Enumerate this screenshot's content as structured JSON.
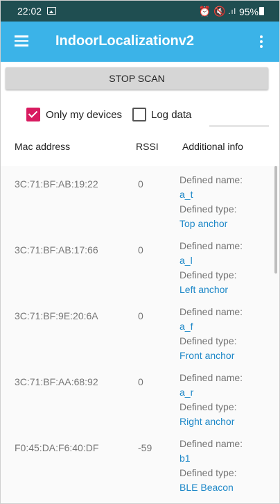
{
  "status_bar": {
    "time": "22:02",
    "battery_percent": "95%",
    "signal_text": ".ıl"
  },
  "app_bar": {
    "title": "IndoorLocalizationv2",
    "color": "#3bb3e8"
  },
  "scan_button": {
    "label": "STOP SCAN"
  },
  "options": {
    "only_my_devices": {
      "label": "Only my devices",
      "checked": true
    },
    "log_data": {
      "label": "Log data",
      "checked": false
    }
  },
  "table": {
    "headers": [
      "Mac address",
      "RSSI",
      "Additional info"
    ],
    "name_label": "Defined name:",
    "type_label": "Defined type:",
    "rows": [
      {
        "mac": "3C:71:BF:AB:19:22",
        "rssi": "0",
        "name": "a_t",
        "type": "Top anchor"
      },
      {
        "mac": "3C:71:BF:AB:17:66",
        "rssi": "0",
        "name": "a_l",
        "type": "Left anchor"
      },
      {
        "mac": "3C:71:BF:9E:20:6A",
        "rssi": "0",
        "name": "a_f",
        "type": "Front anchor"
      },
      {
        "mac": "3C:71:BF:AA:68:92",
        "rssi": "0",
        "name": "a_r",
        "type": "Right anchor"
      },
      {
        "mac": "F0:45:DA:F6:40:DF",
        "rssi": "-59",
        "name": "b1",
        "type": "BLE Beacon"
      }
    ]
  }
}
